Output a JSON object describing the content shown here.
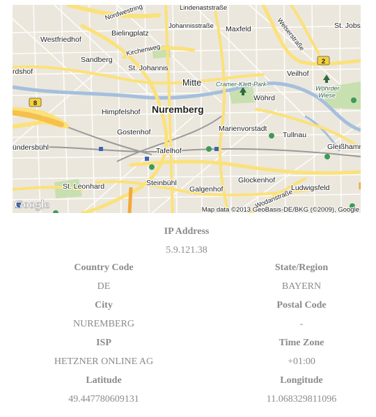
{
  "map": {
    "labels": {
      "nordwestring": "Nordwestring",
      "johannis": "Johannisstraße",
      "lindenast": "Lindenaststraße",
      "maxfeld": "Maxfeld",
      "welser": "Welserstraße",
      "stjobst": "St. Jobst",
      "westfriedhof": "Westfriedhof",
      "bielingplatz": "Bielingplatz",
      "kirchenweg": "Kirchenweg",
      "sandberg": "Sandberg",
      "stjohannis": "St. Johannis",
      "rdshof": "rdshof",
      "mitte": "Mitte",
      "cramer": "Cramer-Klett-Park",
      "woehrd": "Wöhrd",
      "veilhof": "Veilhof",
      "woehrder1": "Wöhrder",
      "woehrder2": "Wiese",
      "himpfelshof": "Himpfelshof",
      "nuremberg": "Nuremberg",
      "marienvorstadt": "Marienvorstadt",
      "tullnau": "Tullnau",
      "gostenhof": "Gostenhof",
      "uendersbuehl": "ündersbühl",
      "tafelhof": "Tafelhof",
      "gleisshammer": "Gleißhamm",
      "steinbuehl": "Steinbühl",
      "stleonhard": "St. Leonhard",
      "galgenhof": "Galgenhof",
      "glockenhof": "Glockenhof",
      "wodan": "Wodanstraße",
      "ludwigsfeld": "Ludwigsfeld",
      "shield2": "2",
      "shield8": "8",
      "google": "Google",
      "attribution": "Map data ©2013 GeoBasis-DE/BKG (©2009), Google"
    }
  },
  "ip": {
    "label": "IP Address",
    "value": "5.9.121.38"
  },
  "fields": [
    {
      "label": "Country Code",
      "value": "DE"
    },
    {
      "label": "State/Region",
      "value": "BAYERN"
    },
    {
      "label": "City",
      "value": "NUREMBERG"
    },
    {
      "label": "Postal Code",
      "value": "-"
    },
    {
      "label": "ISP",
      "value": "HETZNER ONLINE AG"
    },
    {
      "label": "Time Zone",
      "value": "+01:00"
    },
    {
      "label": "Latitude",
      "value": "49.447780609131"
    },
    {
      "label": "Longitude",
      "value": "11.068329811096"
    }
  ]
}
